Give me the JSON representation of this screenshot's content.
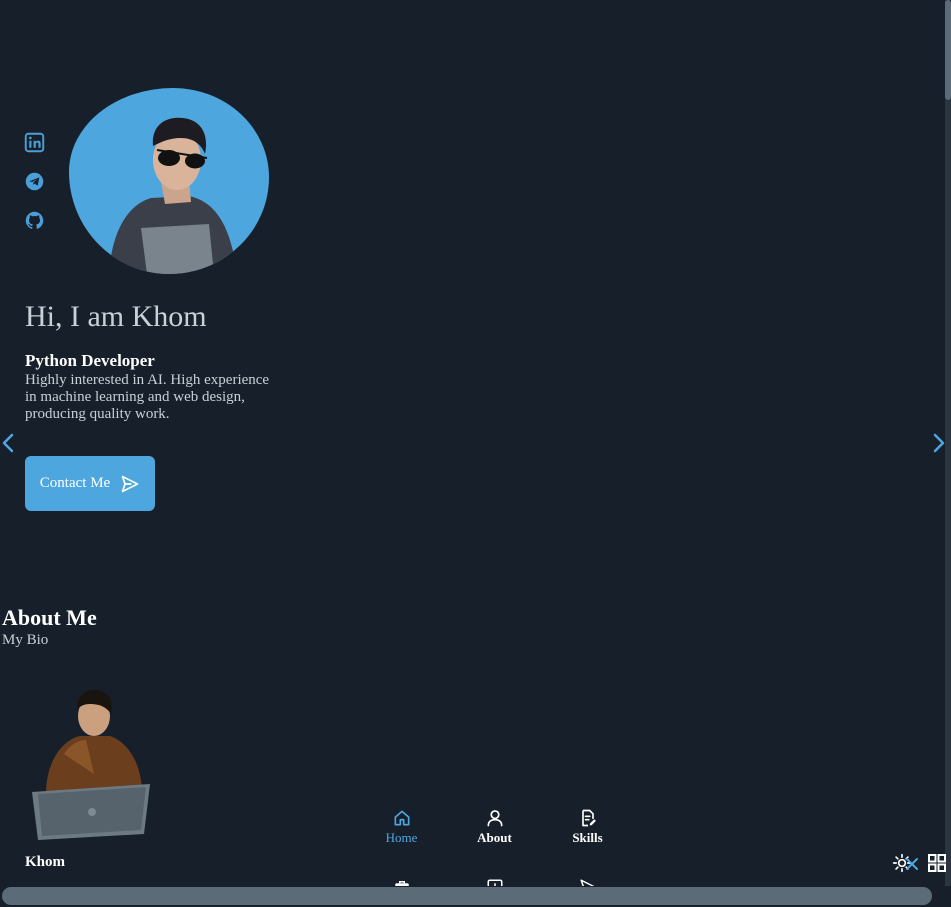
{
  "social": {
    "items": [
      {
        "name": "LinkedIn",
        "icon": "linkedin-icon"
      },
      {
        "name": "Telegram",
        "icon": "telegram-icon"
      },
      {
        "name": "GitHub",
        "icon": "github-icon"
      }
    ]
  },
  "hero": {
    "title": "Hi, I am Khom",
    "subtitle": "Python Developer",
    "description": "Highly interested in AI. High experience in machine learning and web design, producing quality work.",
    "contact_label": "Contact Me"
  },
  "about": {
    "title": "About Me",
    "subtitle": "My Bio"
  },
  "brand": "Khom",
  "nav": {
    "items": [
      {
        "label": "Home",
        "icon": "home-icon",
        "active": true
      },
      {
        "label": "About",
        "icon": "user-icon",
        "active": false
      },
      {
        "label": "Skills",
        "icon": "file-edit-icon",
        "active": false
      }
    ],
    "row2_icons": [
      "briefcase-icon",
      "image-icon",
      "send-icon"
    ]
  },
  "colors": {
    "background": "#17202a",
    "accent": "#4ea6df",
    "text": "#c8d0d8"
  }
}
